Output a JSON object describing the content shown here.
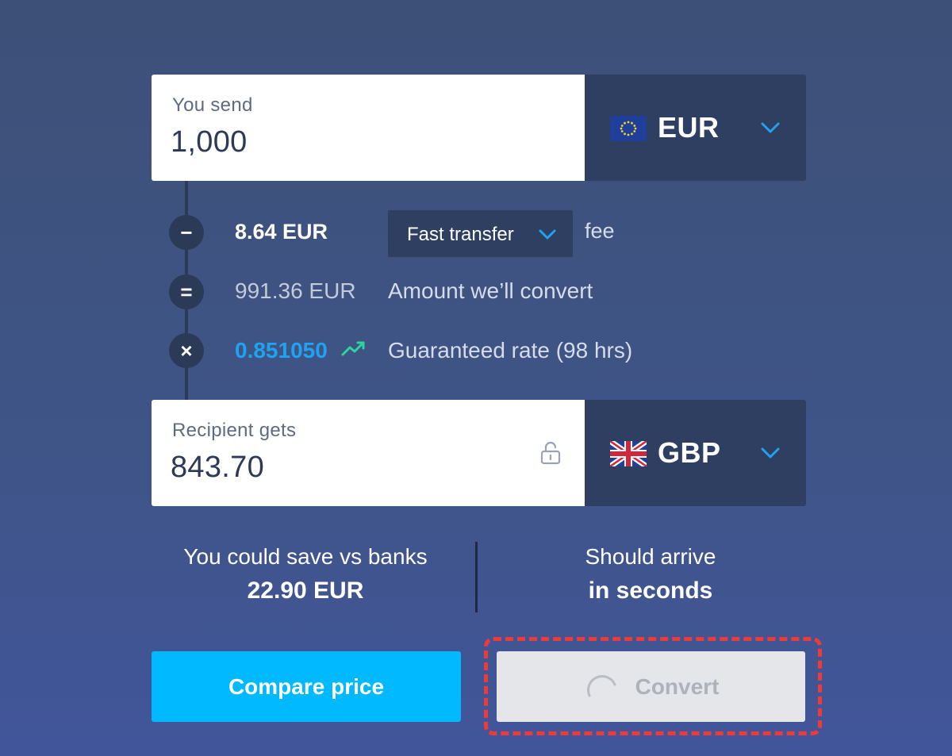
{
  "send": {
    "label": "You send",
    "amount": "1,000",
    "currency": "EUR",
    "flag_icon": "eu-flag-icon"
  },
  "fees": {
    "fee_amount": "8.64 EUR",
    "transfer_type": "Fast transfer",
    "fee_label": "fee",
    "convert_amount": "991.36 EUR",
    "convert_label": "Amount we’ll convert",
    "rate": "0.851050",
    "rate_label": "Guaranteed rate (98 hrs)",
    "step_symbols": [
      "−",
      "=",
      "×"
    ]
  },
  "receive": {
    "label": "Recipient gets",
    "amount": "843.70",
    "currency": "GBP",
    "flag_icon": "uk-flag-icon"
  },
  "savings": {
    "line1": "You could save vs banks",
    "line2": "22.90 EUR"
  },
  "arrival": {
    "line1": "Should arrive",
    "line2": "in seconds"
  },
  "actions": {
    "compare_label": "Compare price",
    "convert_label": "Convert"
  },
  "colors": {
    "accent": "#00b9ff",
    "rate": "#1fa2f0",
    "trend": "#2ed3a0",
    "highlight": "#ef3a3a",
    "panel": "#2e3f62"
  }
}
